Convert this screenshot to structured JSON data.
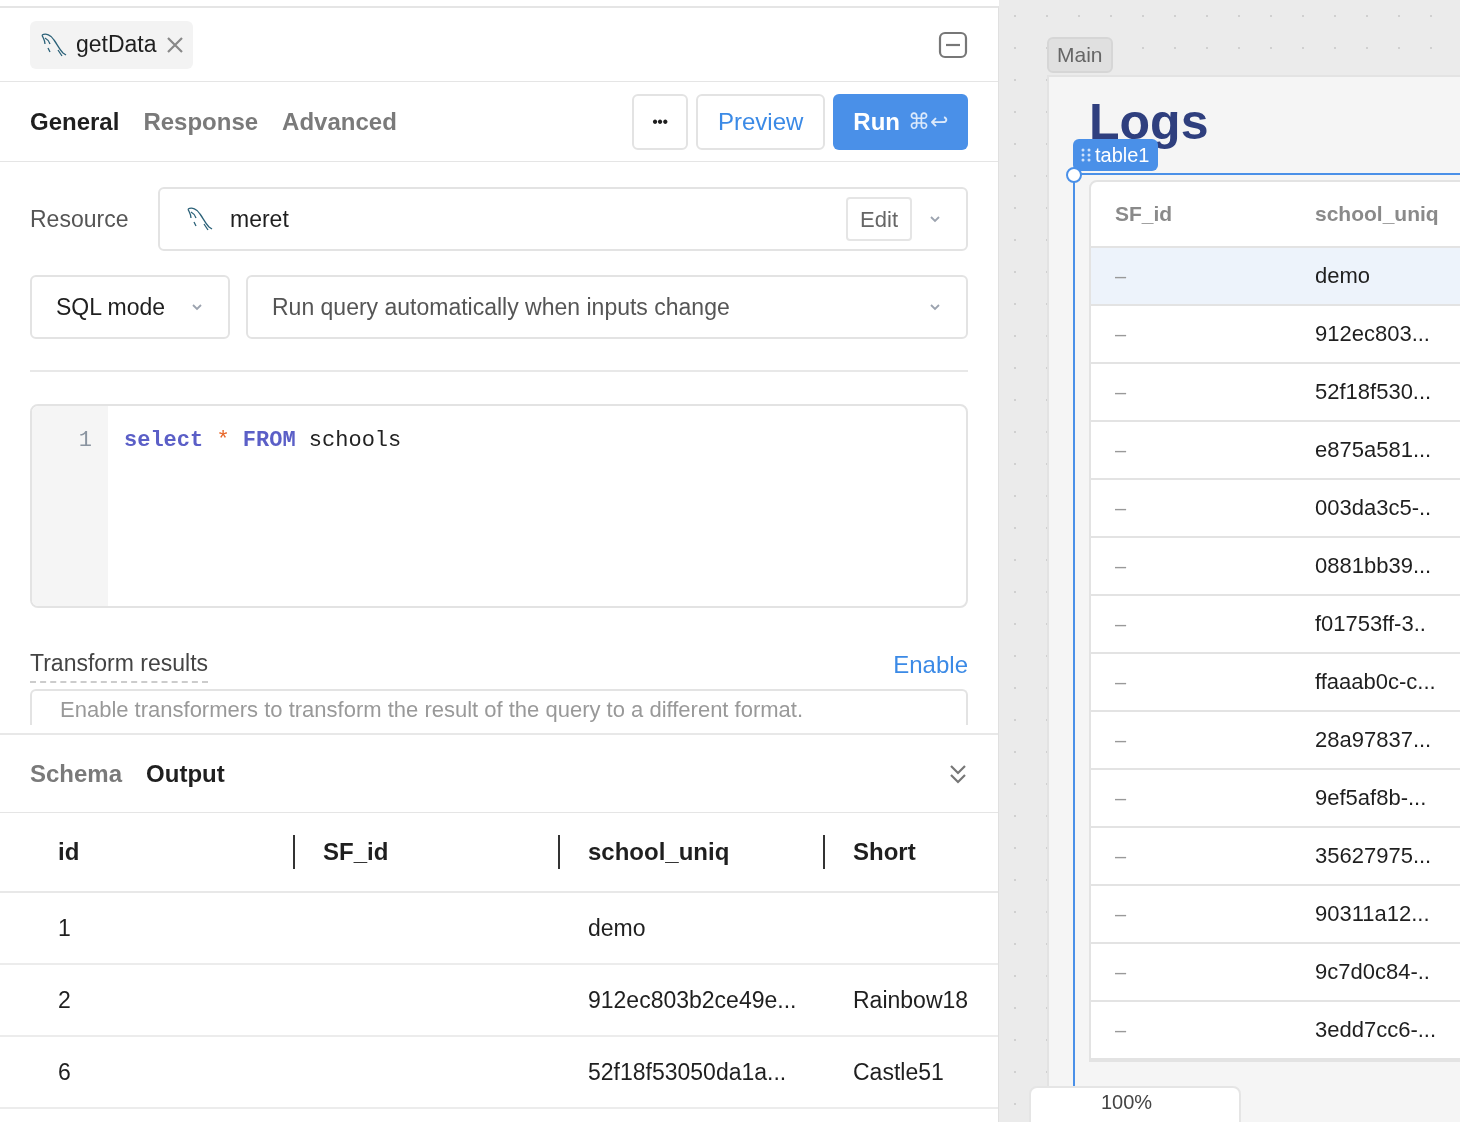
{
  "query_tab": {
    "title": "getData"
  },
  "tabs": [
    {
      "label": "General",
      "selected": true
    },
    {
      "label": "Response",
      "selected": false
    },
    {
      "label": "Advanced",
      "selected": false
    }
  ],
  "actions": {
    "more": "•••",
    "preview": "Preview",
    "run": "Run",
    "run_shortcut": "⌘↩"
  },
  "resource": {
    "label": "Resource",
    "value": "meret",
    "edit": "Edit"
  },
  "mode": {
    "value": "SQL mode"
  },
  "trigger": {
    "value": "Run query automatically when inputs change"
  },
  "editor": {
    "lines": [
      {
        "number": "1",
        "tokens": [
          {
            "kind": "keyword",
            "text": "select"
          },
          {
            "kind": "operator",
            "text": "*"
          },
          {
            "kind": "keyword",
            "text": "FROM"
          },
          {
            "kind": "plain",
            "text": "schools"
          }
        ]
      }
    ]
  },
  "transform": {
    "label": "Transform results",
    "action": "Enable",
    "placeholder": "Enable transformers to transform the result of the query to a different format."
  },
  "result_tabs": [
    {
      "label": "Schema",
      "selected": false
    },
    {
      "label": "Output",
      "selected": true
    }
  ],
  "output_table": {
    "columns": [
      "id",
      "SF_id",
      "school_uniq",
      "Short"
    ],
    "rows": [
      {
        "id": "1",
        "school_uniq": "demo"
      },
      {
        "id": "2",
        "school_uniq": "912ec803b2ce49e...",
        "Short": "Rainbow18"
      },
      {
        "id": "6",
        "school_uniq": "52f18f53050da1a...",
        "Short": "Castle51"
      }
    ]
  },
  "canvas": {
    "page_tab": "Main",
    "title": "Logs",
    "selection_label": "table1",
    "zoom": "100%",
    "table": {
      "columns": [
        "SF_id",
        "school_uniq"
      ],
      "rows": [
        {
          "sf_id": "–",
          "school_uniq": "demo",
          "selected": true
        },
        {
          "sf_id": "–",
          "school_uniq": "912ec803...",
          "selected": false
        },
        {
          "sf_id": "–",
          "school_uniq": "52f18f530...",
          "selected": false
        },
        {
          "sf_id": "–",
          "school_uniq": "e875a581...",
          "selected": false
        },
        {
          "sf_id": "–",
          "school_uniq": "003da3c5-..",
          "selected": false
        },
        {
          "sf_id": "–",
          "school_uniq": "0881bb39...",
          "selected": false
        },
        {
          "sf_id": "–",
          "school_uniq": "f01753ff-3..",
          "selected": false
        },
        {
          "sf_id": "–",
          "school_uniq": "ffaaab0c-c...",
          "selected": false
        },
        {
          "sf_id": "–",
          "school_uniq": "28a97837...",
          "selected": false
        },
        {
          "sf_id": "–",
          "school_uniq": "9ef5af8b-...",
          "selected": false
        },
        {
          "sf_id": "–",
          "school_uniq": "35627975...",
          "selected": false
        },
        {
          "sf_id": "–",
          "school_uniq": "90311a12...",
          "selected": false
        },
        {
          "sf_id": "–",
          "school_uniq": "9c7d0c84-..",
          "selected": false
        },
        {
          "sf_id": "–",
          "school_uniq": "3edd7cc6-...",
          "selected": false
        }
      ]
    }
  }
}
